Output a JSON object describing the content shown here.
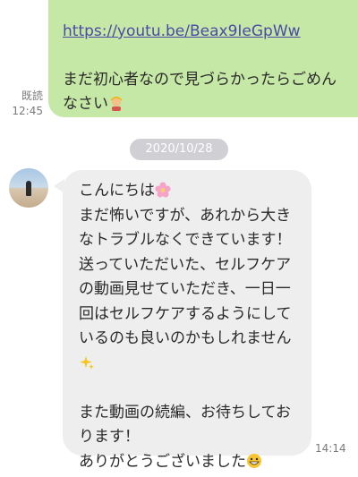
{
  "sent_message": {
    "link": "https://youtu.be/Beax9IeGpWw",
    "text": "まだ初心者なので見づらかったらごめんなさい",
    "read_label": "既読",
    "time": "12:45"
  },
  "date_separator": "2020/10/28",
  "received_message": {
    "line1": "こんにちは",
    "text1": "まだ怖いですが、あれから大きなトラブルなくできています！送っていただいた、セルフケアの動画見せていただき、一日一回はセルフケアするようにしているのも良いのかもしれません",
    "text2": "また動画の続編、お待ちしております！",
    "text3": "ありがとうございました",
    "time": "14:14"
  },
  "icons": [
    "bowing-person-emoji",
    "cherry-blossom-emoji",
    "sparkles-emoji",
    "grinning-face-emoji"
  ],
  "colors": {
    "sent_bubble": "#c6e8a7",
    "received_bubble": "#eeeeef",
    "link": "#4a4aa8"
  }
}
